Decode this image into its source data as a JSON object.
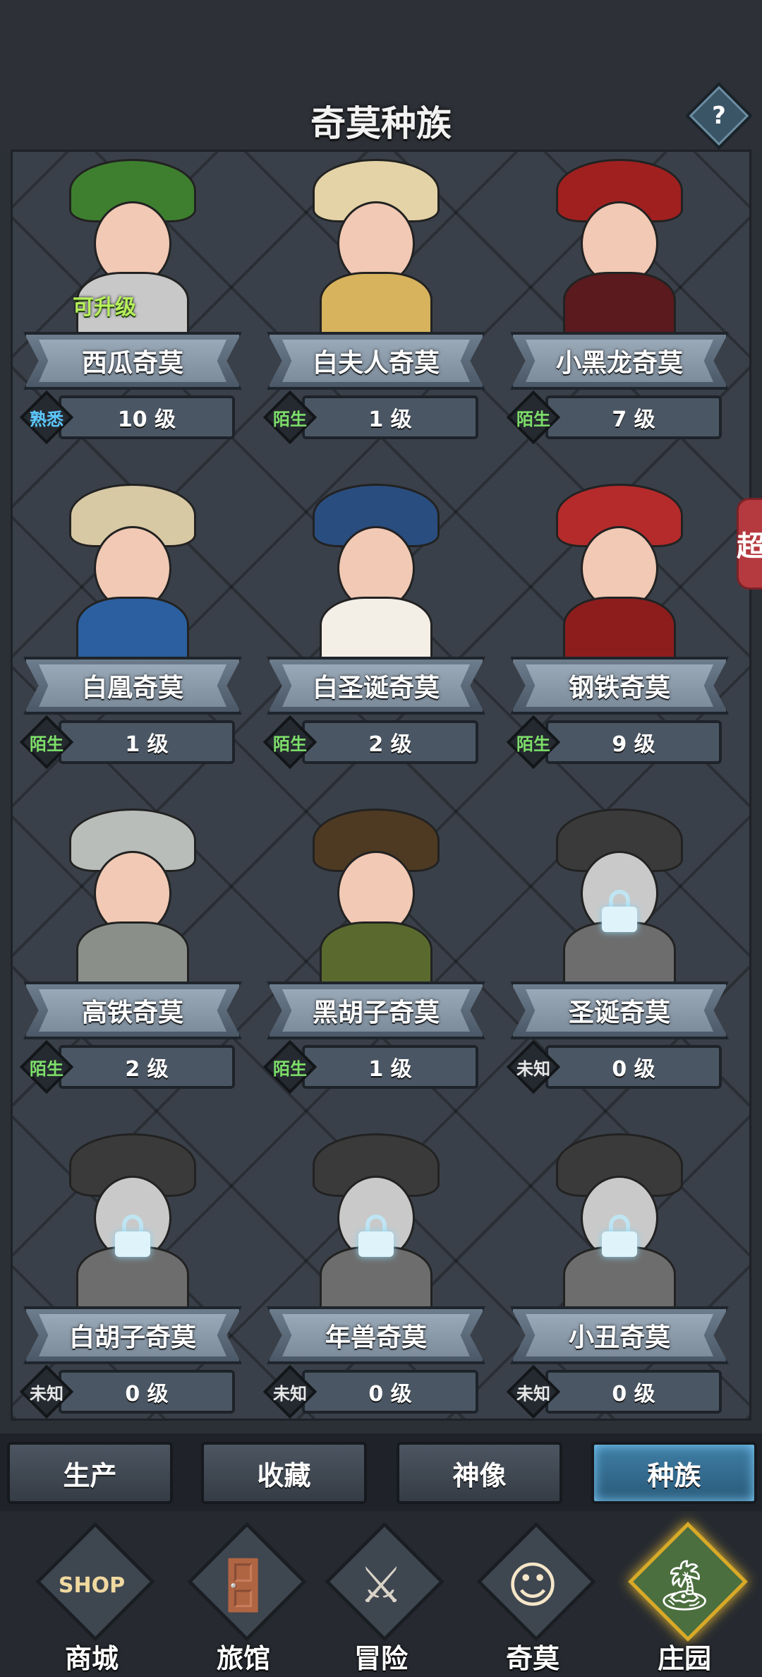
{
  "header": {
    "title": "奇莫种族",
    "help_label": "?"
  },
  "side_tab": {
    "label": "超"
  },
  "status_colors": {
    "熟悉": "#5cc8ff",
    "陌生": "#7ee06a",
    "未知": "#e8e8e8"
  },
  "cards": [
    {
      "name": "西瓜奇莫",
      "status": "熟悉",
      "level": "10 级",
      "tag": "可升级",
      "locked": false
    },
    {
      "name": "白夫人奇莫",
      "status": "陌生",
      "level": "1 级",
      "locked": false
    },
    {
      "name": "小黑龙奇莫",
      "status": "陌生",
      "level": "7 级",
      "locked": false
    },
    {
      "name": "白凰奇莫",
      "status": "陌生",
      "level": "1 级",
      "locked": false
    },
    {
      "name": "白圣诞奇莫",
      "status": "陌生",
      "level": "2 级",
      "locked": false
    },
    {
      "name": "钢铁奇莫",
      "status": "陌生",
      "level": "9 级",
      "locked": false
    },
    {
      "name": "高铁奇莫",
      "status": "陌生",
      "level": "2 级",
      "locked": false
    },
    {
      "name": "黑胡子奇莫",
      "status": "陌生",
      "level": "1 级",
      "locked": false
    },
    {
      "name": "圣诞奇莫",
      "status": "未知",
      "level": "0 级",
      "locked": true
    },
    {
      "name": "白胡子奇莫",
      "status": "未知",
      "level": "0 级",
      "locked": true
    },
    {
      "name": "年兽奇莫",
      "status": "未知",
      "level": "0 级",
      "locked": true
    },
    {
      "name": "小丑奇莫",
      "status": "未知",
      "level": "0 级",
      "locked": true
    }
  ],
  "tabs": [
    {
      "label": "生产",
      "active": false
    },
    {
      "label": "收藏",
      "active": false
    },
    {
      "label": "神像",
      "active": false
    },
    {
      "label": "种族",
      "active": true
    }
  ],
  "nav": [
    {
      "label": "商城",
      "icon": "shop-icon",
      "glyph": "SHOP",
      "active": false
    },
    {
      "label": "旅馆",
      "icon": "inn-icon",
      "glyph": "🚪",
      "active": false
    },
    {
      "label": "冒险",
      "icon": "crossed-swords-icon",
      "glyph": "⚔",
      "active": false
    },
    {
      "label": "奇莫",
      "icon": "qimo-icon",
      "glyph": "☺",
      "active": false
    },
    {
      "label": "庄园",
      "icon": "manor-icon",
      "glyph": "🏝",
      "active": true
    }
  ]
}
